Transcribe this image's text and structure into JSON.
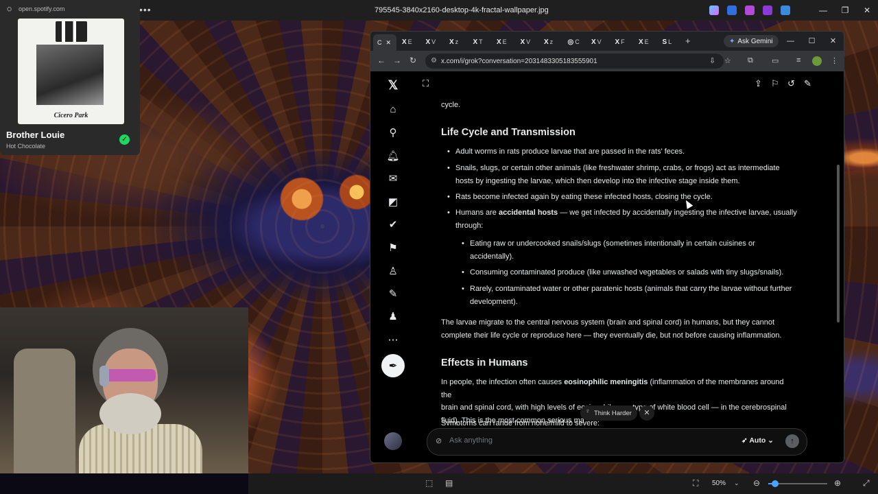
{
  "window_title": "795545-3840x2160-desktop-4k-fractal-wallpaper.jpg",
  "spotify": {
    "url": "open.spotify.com",
    "album_caption": "Cicero Park",
    "track_title": "Brother Louie",
    "artist": "Hot Chocolate"
  },
  "browser": {
    "tabs": [
      {
        "fav": "X",
        "letter": "E"
      },
      {
        "fav": "X",
        "letter": "V"
      },
      {
        "fav": "X",
        "letter": "z"
      },
      {
        "fav": "X",
        "letter": "T"
      },
      {
        "fav": "X",
        "letter": "E"
      },
      {
        "fav": "X",
        "letter": "V"
      },
      {
        "fav": "X",
        "letter": "z"
      },
      {
        "fav": "◎",
        "letter": "C"
      },
      {
        "fav": "X",
        "letter": "V"
      },
      {
        "fav": "X",
        "letter": "F"
      },
      {
        "fav": "X",
        "letter": "E"
      },
      {
        "fav": "S",
        "letter": "L"
      }
    ],
    "active_tab_letter": "C",
    "ask_gemini": "Ask Gemini",
    "url": "x.com/i/grok?conversation=2031483305183555901"
  },
  "chat": {
    "top_fragment": "cycle.",
    "heading_lifecycle": "Life Cycle and Transmission",
    "bullet1": "Adult worms in rats produce larvae that are passed in the rats' feces.",
    "bullet2_line1": "Snails, slugs, or certain other animals (like freshwater shrimp, crabs, or frogs) act as intermediate",
    "bullet2_line2": "hosts by ingesting the larvae, which then develop into the infective stage inside them.",
    "bullet3": "Rats become infected again by eating these infected hosts, closing the cycle.",
    "bullet4_pre": "Humans are ",
    "bullet4_bold": "accidental hosts",
    "bullet4_post": " — we get infected by accidentally ingesting the infective larvae, usually",
    "bullet4_line2": "through:",
    "sub1_line1": "Eating raw or undercooked snails/slugs (sometimes intentionally in certain cuisines or",
    "sub1_line2": "accidentally).",
    "sub2": "Consuming contaminated produce (like unwashed vegetables or salads with tiny slugs/snails).",
    "sub3_line1": "Rarely, contaminated water or other paratenic hosts (animals that carry the larvae without further",
    "sub3_line2": "development).",
    "para1_line1": "The larvae migrate to the central nervous system (brain and spinal cord) in humans, but they cannot",
    "para1_line2": "complete their life cycle or reproduce here — they eventually die, but not before causing inflammation.",
    "heading_effects": "Effects in Humans",
    "para2_pre": "In people, the infection often causes ",
    "para2_bold": "eosinophilic meningitis",
    "para2_post": " (inflammation of the membranes around the",
    "para2_line2": "brain and spinal cord, with high levels of eosinophils — a type of white blood cell — in the cerebrospinal",
    "para2_line3": "fluid). This is the most common serious ma",
    "para3": "Symptoms can range from none/mild to severe:",
    "think_harder": "Think Harder",
    "ask_placeholder": "Ask anything",
    "mode": "Auto"
  },
  "bottom": {
    "zoom": "50%",
    "zoom_fraction": 0.12
  }
}
